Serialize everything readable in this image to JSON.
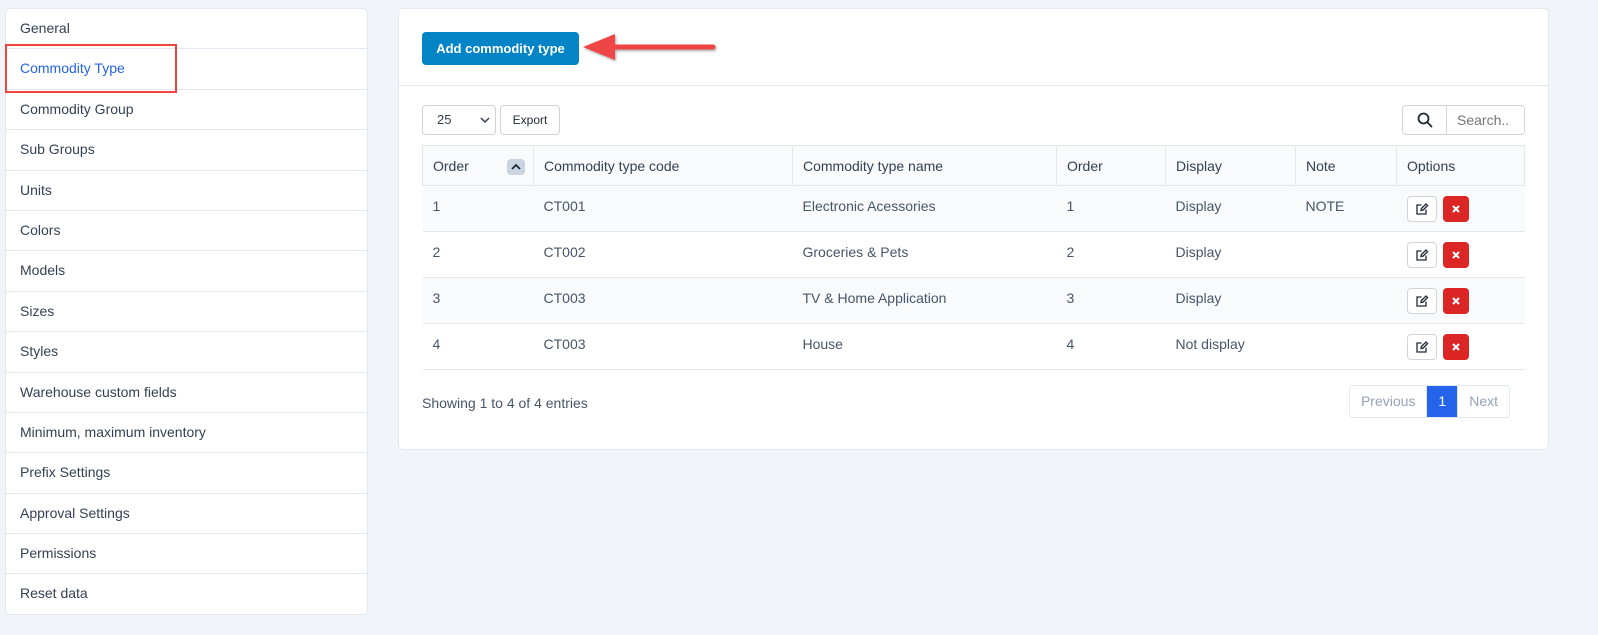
{
  "sidebar": {
    "items": [
      {
        "label": "General"
      },
      {
        "label": "Commodity Type"
      },
      {
        "label": "Commodity Group"
      },
      {
        "label": "Sub Groups"
      },
      {
        "label": "Units"
      },
      {
        "label": "Colors"
      },
      {
        "label": "Models"
      },
      {
        "label": "Sizes"
      },
      {
        "label": "Styles"
      },
      {
        "label": "Warehouse custom fields"
      },
      {
        "label": "Minimum, maximum inventory"
      },
      {
        "label": "Prefix Settings"
      },
      {
        "label": "Approval Settings"
      },
      {
        "label": "Permissions"
      },
      {
        "label": "Reset data"
      }
    ],
    "active_item": "Commodity Type"
  },
  "main": {
    "add_button": "Add commodity type",
    "page_length": "25",
    "export_label": "Export",
    "search_placeholder": "Search..",
    "table": {
      "headers": [
        "Order",
        "Commodity type code",
        "Commodity type name",
        "Order",
        "Display",
        "Note",
        "Options"
      ],
      "rows": [
        {
          "order": "1",
          "code": "CT001",
          "name": "Electronic Acessories",
          "order2": "1",
          "display": "Display",
          "note": "NOTE"
        },
        {
          "order": "2",
          "code": "CT002",
          "name": "Groceries & Pets",
          "order2": "2",
          "display": "Display",
          "note": ""
        },
        {
          "order": "3",
          "code": "CT003",
          "name": "TV & Home Application",
          "order2": "3",
          "display": "Display",
          "note": ""
        },
        {
          "order": "4",
          "code": "CT003",
          "name": "House",
          "order2": "4",
          "display": "Not display",
          "note": ""
        }
      ]
    },
    "info": "Showing 1 to 4 of 4 entries",
    "pagination": {
      "previous": "Previous",
      "current": "1",
      "next": "Next"
    }
  },
  "icons": {
    "sort": "chevron-up-icon",
    "search": "search-icon",
    "edit": "edit-icon",
    "delete": "close-icon",
    "annotation": "red-arrow-icon"
  },
  "colors": {
    "accent": "#0284c7",
    "active_link": "#2563eb",
    "danger": "#dc2626",
    "annotation": "#ef4444"
  }
}
